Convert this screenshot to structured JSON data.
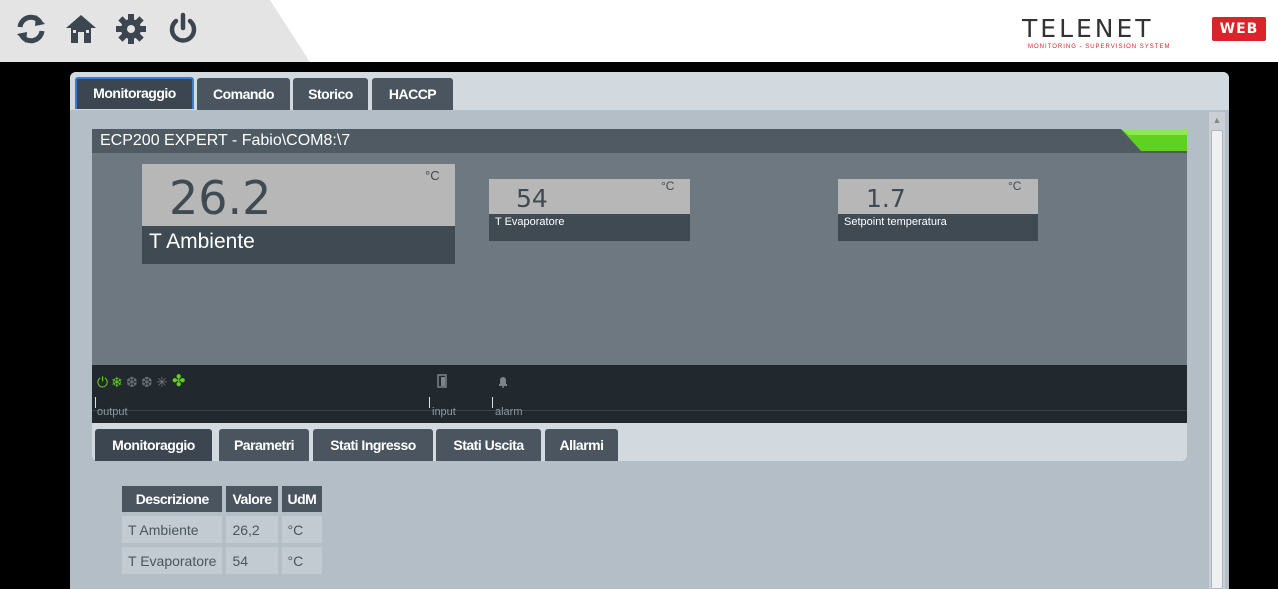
{
  "toolbar": {
    "icons": [
      "refresh-icon",
      "home-icon",
      "gear-icon",
      "power-icon"
    ]
  },
  "brand": {
    "name": "TELENET",
    "badge": "WEB",
    "tagline": "MONITORING - SUPERVISION SYSTEM"
  },
  "main_tabs": [
    {
      "label": "Monitoraggio",
      "active": true
    },
    {
      "label": "Comando",
      "active": false
    },
    {
      "label": "Storico",
      "active": false
    },
    {
      "label": "HACCP",
      "active": false
    }
  ],
  "device": {
    "title": "ECP200 EXPERT - Fabio\\COM8:\\7",
    "status_color": "#5fd21f",
    "gauges": [
      {
        "value": "26.2",
        "unit": "°C",
        "label": "T Ambiente"
      },
      {
        "value": "54",
        "unit": "°C",
        "label": "T Evaporatore"
      },
      {
        "value": "1.7",
        "unit": "°C",
        "label": "Setpoint temperatura"
      }
    ],
    "io": {
      "output_label": "output",
      "input_label": "input",
      "alarm_label": "alarm",
      "output_icons": [
        "power-icon",
        "snowflake-icon",
        "defrost-icon",
        "defrost-icon",
        "light-snowflake-icon",
        "fan-icon"
      ],
      "input_icons": [
        "door-icon"
      ],
      "alarm_icons": [
        "bell-icon"
      ]
    }
  },
  "sub_tabs": [
    {
      "label": "Monitoraggio",
      "active": true
    },
    {
      "label": "Parametri",
      "active": false
    },
    {
      "label": "Stati Ingresso",
      "active": false
    },
    {
      "label": "Stati Uscita",
      "active": false
    },
    {
      "label": "Allarmi",
      "active": false
    }
  ],
  "table": {
    "headers": [
      "Descrizione",
      "Valore",
      "UdM"
    ],
    "rows": [
      [
        "T Ambiente",
        "26,2",
        "°C"
      ],
      [
        "T Evaporatore",
        "54",
        "°C"
      ]
    ]
  },
  "colors": {
    "accent_green": "#5fd21f",
    "brand_red": "#d8242a",
    "tab_active_border": "#3a7bd5"
  }
}
